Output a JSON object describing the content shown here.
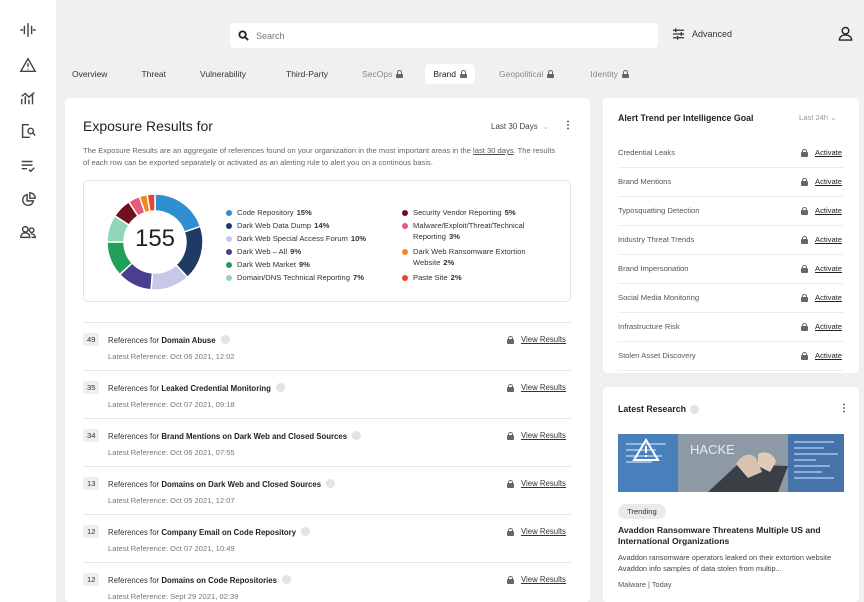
{
  "search": {
    "placeholder": "Search"
  },
  "header": {
    "advanced_label": "Advanced"
  },
  "tabs": [
    {
      "label": "Overview",
      "locked": false,
      "active": false
    },
    {
      "label": "Threat",
      "locked": false,
      "active": false
    },
    {
      "label": "Vulnerability",
      "locked": false,
      "active": false
    },
    {
      "label": "Third-Party",
      "locked": false,
      "active": false
    },
    {
      "label": "SecOps",
      "locked": true,
      "active": false
    },
    {
      "label": "Brand",
      "locked": true,
      "active": true
    },
    {
      "label": "Geopolitical",
      "locked": true,
      "active": false
    },
    {
      "label": "Identity",
      "locked": true,
      "active": false
    }
  ],
  "exposure": {
    "title": "Exposure Results for",
    "range": "Last 30 Days",
    "description_1": "The Exposure Results are an aggregate of references found on your organization in the most important areas in the ",
    "description_link": "last 30 days",
    "description_2": ". The results of each row can be exported separately or activated as an alerting rule to alert you on a continous basis.",
    "total": "155"
  },
  "chart_data": {
    "type": "pie",
    "total": 155,
    "categories": [
      "Code Repository",
      "Dark Web Data Dump",
      "Dark Web Special Access Forum",
      "Dark Web – All",
      "Dark Web Market",
      "Domain/DNS Technical Reporting",
      "Security Vendor Reporting",
      "Malware/Exploit/Threat/Technical Reporting",
      "Dark Web Ransomware Extortion Website",
      "Paste Site"
    ],
    "values": [
      15,
      14,
      10,
      9,
      9,
      7,
      5,
      3,
      2,
      2
    ],
    "colors": [
      "#2f8fd2",
      "#1f3a64",
      "#c5c8e8",
      "#4a3e8e",
      "#21a05a",
      "#8fd7b8",
      "#6e1020",
      "#e6597b",
      "#f08a1c",
      "#e8452e"
    ]
  },
  "legend": [
    {
      "label": "Code Repository",
      "pct": "15%"
    },
    {
      "label": "Dark Web Data Dump",
      "pct": "14%"
    },
    {
      "label": "Dark Web Special Access Forum",
      "pct": "10%"
    },
    {
      "label": "Dark Web – All",
      "pct": "9%"
    },
    {
      "label": "Dark Web Market",
      "pct": "9%"
    },
    {
      "label": "Domain/DNS Technical Reporting",
      "pct": "7%"
    },
    {
      "label": "Security Vendor Reporting",
      "pct": "5%"
    },
    {
      "label": "Malware/Exploit/Threat/Technical",
      "label2": "Reporting",
      "pct": "3%"
    },
    {
      "label": "Dark Web Ransomware Extortion",
      "label2": "Website",
      "pct": "2%"
    },
    {
      "label": "Paste Site",
      "pct": "2%"
    }
  ],
  "references": [
    {
      "count": "49",
      "prefix": "References for ",
      "topic": "Domain Abuse",
      "latest": "Latest Reference: Oct 06 2021, 12:02",
      "action": "View Results"
    },
    {
      "count": "35",
      "prefix": "References for ",
      "topic": "Leaked Credential Monitoring",
      "latest": "Latest Reference: Oct 07 2021, 09:18",
      "action": "View Results"
    },
    {
      "count": "34",
      "prefix": "References for ",
      "topic": "Brand Mentions on Dark Web and Closed Sources",
      "latest": "Latest Reference: Oct 06 2021, 07:55",
      "action": "View Results"
    },
    {
      "count": "13",
      "prefix": "References for ",
      "topic": "Domains on Dark Web and Closed Sources",
      "latest": "Latest Reference: Oct 05 2021, 12:07",
      "action": "View Results"
    },
    {
      "count": "12",
      "prefix": "References for ",
      "topic": "Company Email on Code Repository",
      "latest": "Latest Reference: Oct 07 2021, 10:49",
      "action": "View Results"
    },
    {
      "count": "12",
      "prefix": "References for ",
      "topic": "Domains on Code Repositories",
      "latest": "Latest Reference: Sept 29 2021, 02:39",
      "action": "View Results"
    }
  ],
  "trend": {
    "title": "Alert Trend per Intelligence Goal",
    "range": "Last 24h",
    "action": "Activate",
    "items": [
      "Credential Leaks",
      "Brand Mentions",
      "Typosquatting Detection",
      "Industry Threat Trends",
      "Brand Impersonation",
      "Social Media Monitoring",
      "Infrastructure Risk",
      "Stolen Asset Discovery"
    ]
  },
  "research": {
    "title": "Latest Research",
    "badge": "Trending",
    "headline": "Avaddon Ransomware Threatens Multiple US and International Organizations",
    "body": "Avaddon ransomware operators leaked on their extortion website Avaddon info samples of data stolen from multip...",
    "category": "Malware",
    "date": "Today",
    "image_text": "HACKE"
  }
}
